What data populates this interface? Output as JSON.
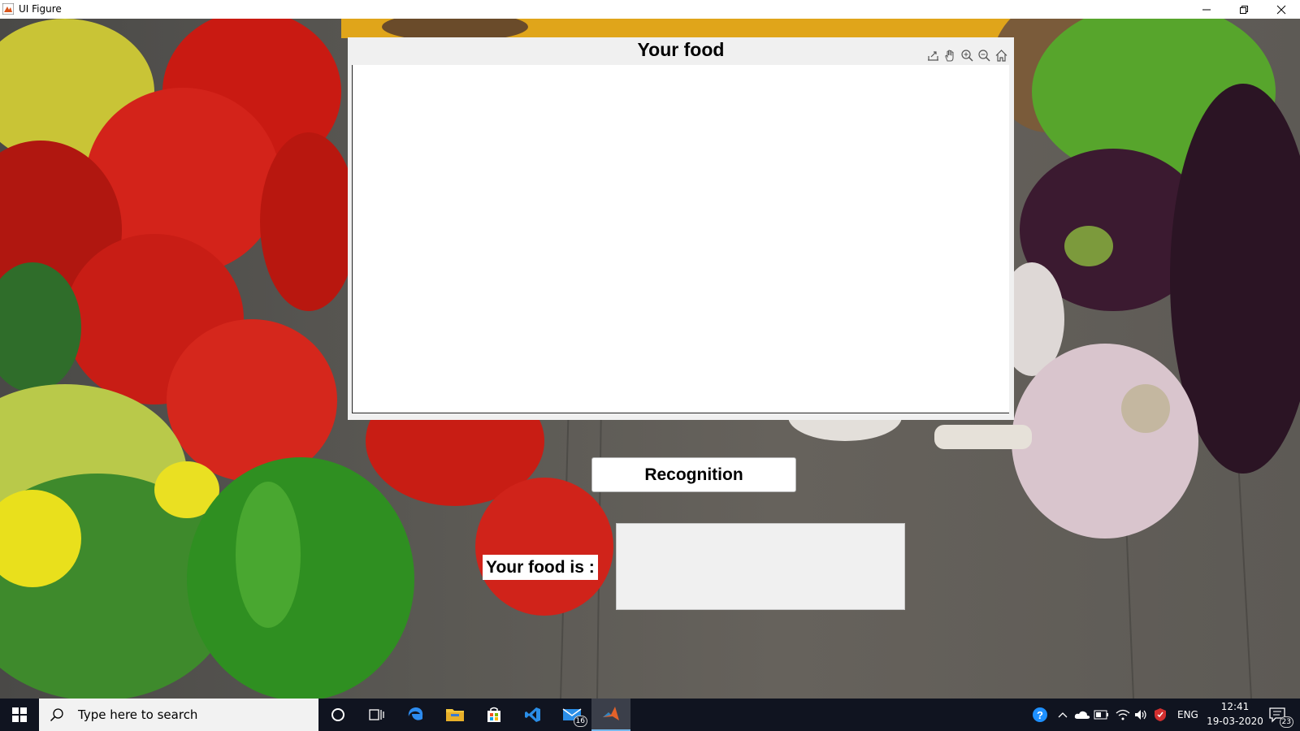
{
  "window": {
    "title": "UI Figure",
    "controls": [
      "minimize",
      "restore",
      "close"
    ]
  },
  "axes": {
    "title": "Your food",
    "toolbar": [
      "export-icon",
      "pan-icon",
      "zoom-in-icon",
      "zoom-out-icon",
      "home-icon"
    ]
  },
  "recognition_button": {
    "label": "Recognition"
  },
  "result": {
    "label": "Your food is :",
    "value": ""
  },
  "taskbar": {
    "search_placeholder": "Type here to search",
    "apps": [
      {
        "name": "cortana-icon"
      },
      {
        "name": "task-view-icon"
      },
      {
        "name": "edge-icon"
      },
      {
        "name": "file-explorer-icon"
      },
      {
        "name": "store-icon"
      },
      {
        "name": "visual-studio-code-icon"
      },
      {
        "name": "mail-icon",
        "badge": "16"
      },
      {
        "name": "matlab-icon",
        "active": true
      }
    ],
    "tray": {
      "language": "ENG",
      "time": "12:41",
      "date": "19-03-2020",
      "notifications": "23"
    }
  },
  "colors": {
    "taskbar": "#101420",
    "panel": "#f0f0f0",
    "accent": "#76b9ed"
  }
}
